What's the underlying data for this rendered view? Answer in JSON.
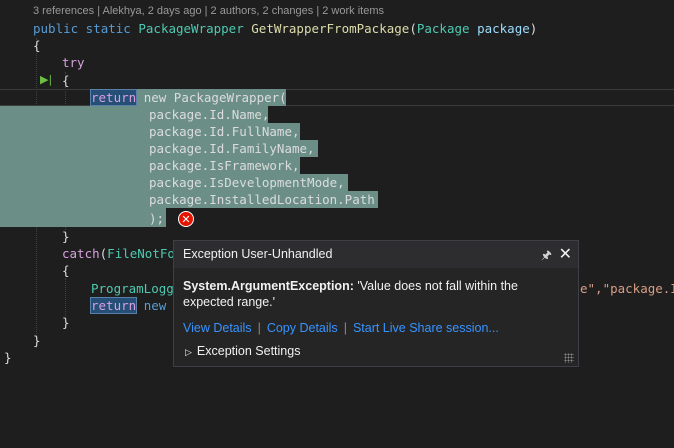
{
  "codelens": "3 references | Alekhya, 2 days ago | 2 authors, 2 changes | 2 work items",
  "code": {
    "signature": {
      "kw": "public static",
      "type": "PackageWrapper",
      "method": "GetWrapperFromPackage",
      "open": "(",
      "ptype": "Package",
      "pname": "package",
      "close": ")"
    },
    "brace_open": "{",
    "try_kw": "try",
    "inner_open": "{",
    "return_kw": "return",
    "new_stmt": "new PackageWrapper(",
    "args": [
      "package.Id.Name,",
      "package.Id.FullName,",
      "package.Id.FamilyName,",
      "package.IsFramework,",
      "package.IsDevelopmentMode,",
      "package.InstalledLocation.Path"
    ],
    "closing": ");",
    "inner_close": "}",
    "catch_line": "catch(FileNotFo",
    "catch_open": "{",
    "logger": "ProgramLogg",
    "return_kw2": "return",
    "new_partial": "new P",
    "catch_close": "}",
    "method_close": "}",
    "class_close": "}",
    "right_fragment_a": "e\",",
    "right_fragment_b": "\"package.I"
  },
  "exception_popup": {
    "title": "Exception User-Unhandled",
    "exception_type": "System.ArgumentException:",
    "message": "'Value does not fall within the expected range.'",
    "links": [
      "View Details",
      "Copy Details",
      "Start Live Share session..."
    ],
    "settings_label": "Exception Settings",
    "pin_icon": "pin-icon",
    "close_icon": "close-icon"
  },
  "colors": {
    "background": "#1e1e1e",
    "selection": "#6b8f86",
    "error": "#e51400",
    "link": "#3794ff"
  }
}
